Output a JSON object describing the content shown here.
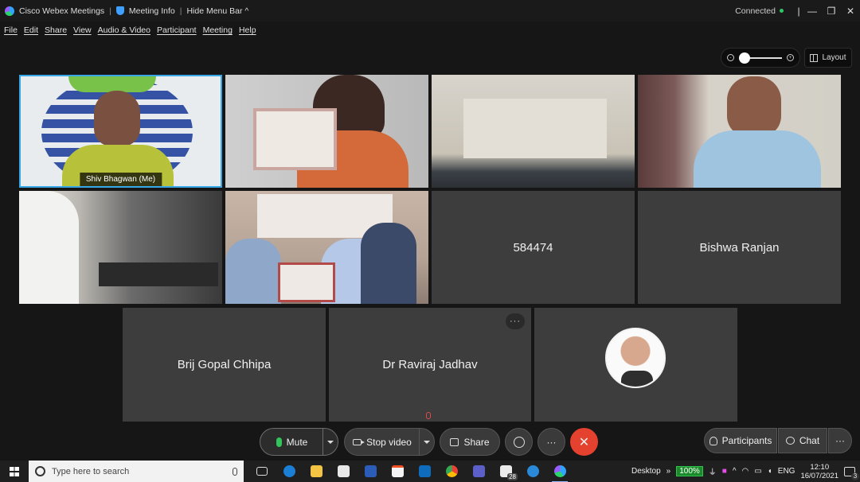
{
  "titlebar": {
    "app_title": "Cisco Webex Meetings",
    "meeting_info": "Meeting Info",
    "hide_menu": "Hide Menu Bar",
    "status": "Connected"
  },
  "menu": [
    "File",
    "Edit",
    "Share",
    "View",
    "Audio & Video",
    "Participant",
    "Meeting",
    "Help"
  ],
  "layout_label": "Layout",
  "tiles": {
    "self_name": "Shiv Bhagwan  (Me)",
    "t7_name": "584474",
    "t8_name": "Bishwa Ranjan",
    "t9_name": "Brij Gopal Chhipa",
    "t10_name": "Dr Raviraj Jadhav",
    "t10_more": "···"
  },
  "controls": {
    "mute": "Mute",
    "stop_video": "Stop video",
    "share": "Share",
    "more": "···",
    "end": "✕",
    "participants": "Participants",
    "chat": "Chat",
    "panel_more": "···"
  },
  "taskbar": {
    "search_placeholder": "Type here to search",
    "mail_badge": "28",
    "desktop_label": "Desktop",
    "battery": "100%",
    "language": "ENG",
    "time": "12:10",
    "date": "16/07/2021",
    "notif_count": "3"
  },
  "colors": {
    "accent_border": "#38a7e8",
    "end_red": "#e5412f",
    "mic_green": "#31c45a",
    "connected_green": "#2fc766"
  }
}
